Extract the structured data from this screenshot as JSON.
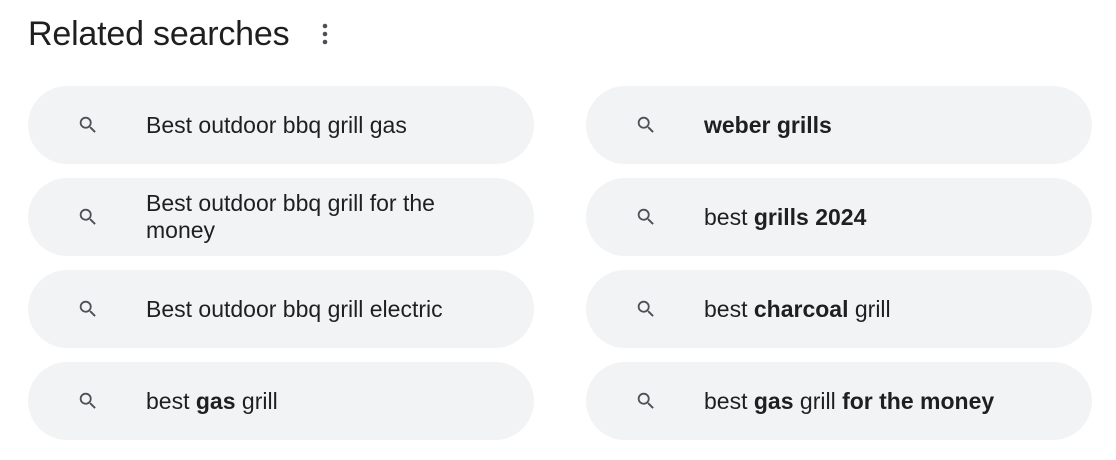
{
  "header": {
    "title": "Related searches"
  },
  "related_searches": [
    {
      "segments": [
        {
          "text": "Best outdoor bbq grill gas",
          "bold": false
        }
      ]
    },
    {
      "segments": [
        {
          "text": "weber grills",
          "bold": true
        }
      ]
    },
    {
      "segments": [
        {
          "text": "Best outdoor bbq grill for the money",
          "bold": false
        }
      ]
    },
    {
      "segments": [
        {
          "text": "best ",
          "bold": false
        },
        {
          "text": "grills 2024",
          "bold": true
        }
      ]
    },
    {
      "segments": [
        {
          "text": "Best outdoor bbq grill electric",
          "bold": false
        }
      ]
    },
    {
      "segments": [
        {
          "text": "best ",
          "bold": false
        },
        {
          "text": "charcoal",
          "bold": true
        },
        {
          "text": " grill",
          "bold": false
        }
      ]
    },
    {
      "segments": [
        {
          "text": "best ",
          "bold": false
        },
        {
          "text": "gas",
          "bold": true
        },
        {
          "text": " grill",
          "bold": false
        }
      ]
    },
    {
      "segments": [
        {
          "text": "best ",
          "bold": false
        },
        {
          "text": "gas",
          "bold": true
        },
        {
          "text": " grill ",
          "bold": false
        },
        {
          "text": "for the money",
          "bold": true
        }
      ]
    }
  ],
  "icons": {
    "search": "search-icon",
    "more": "more-vert-icon"
  },
  "colors": {
    "chip_background": "#f1f3f4",
    "text": "#1f1f1f",
    "icon": "#4d5156"
  }
}
